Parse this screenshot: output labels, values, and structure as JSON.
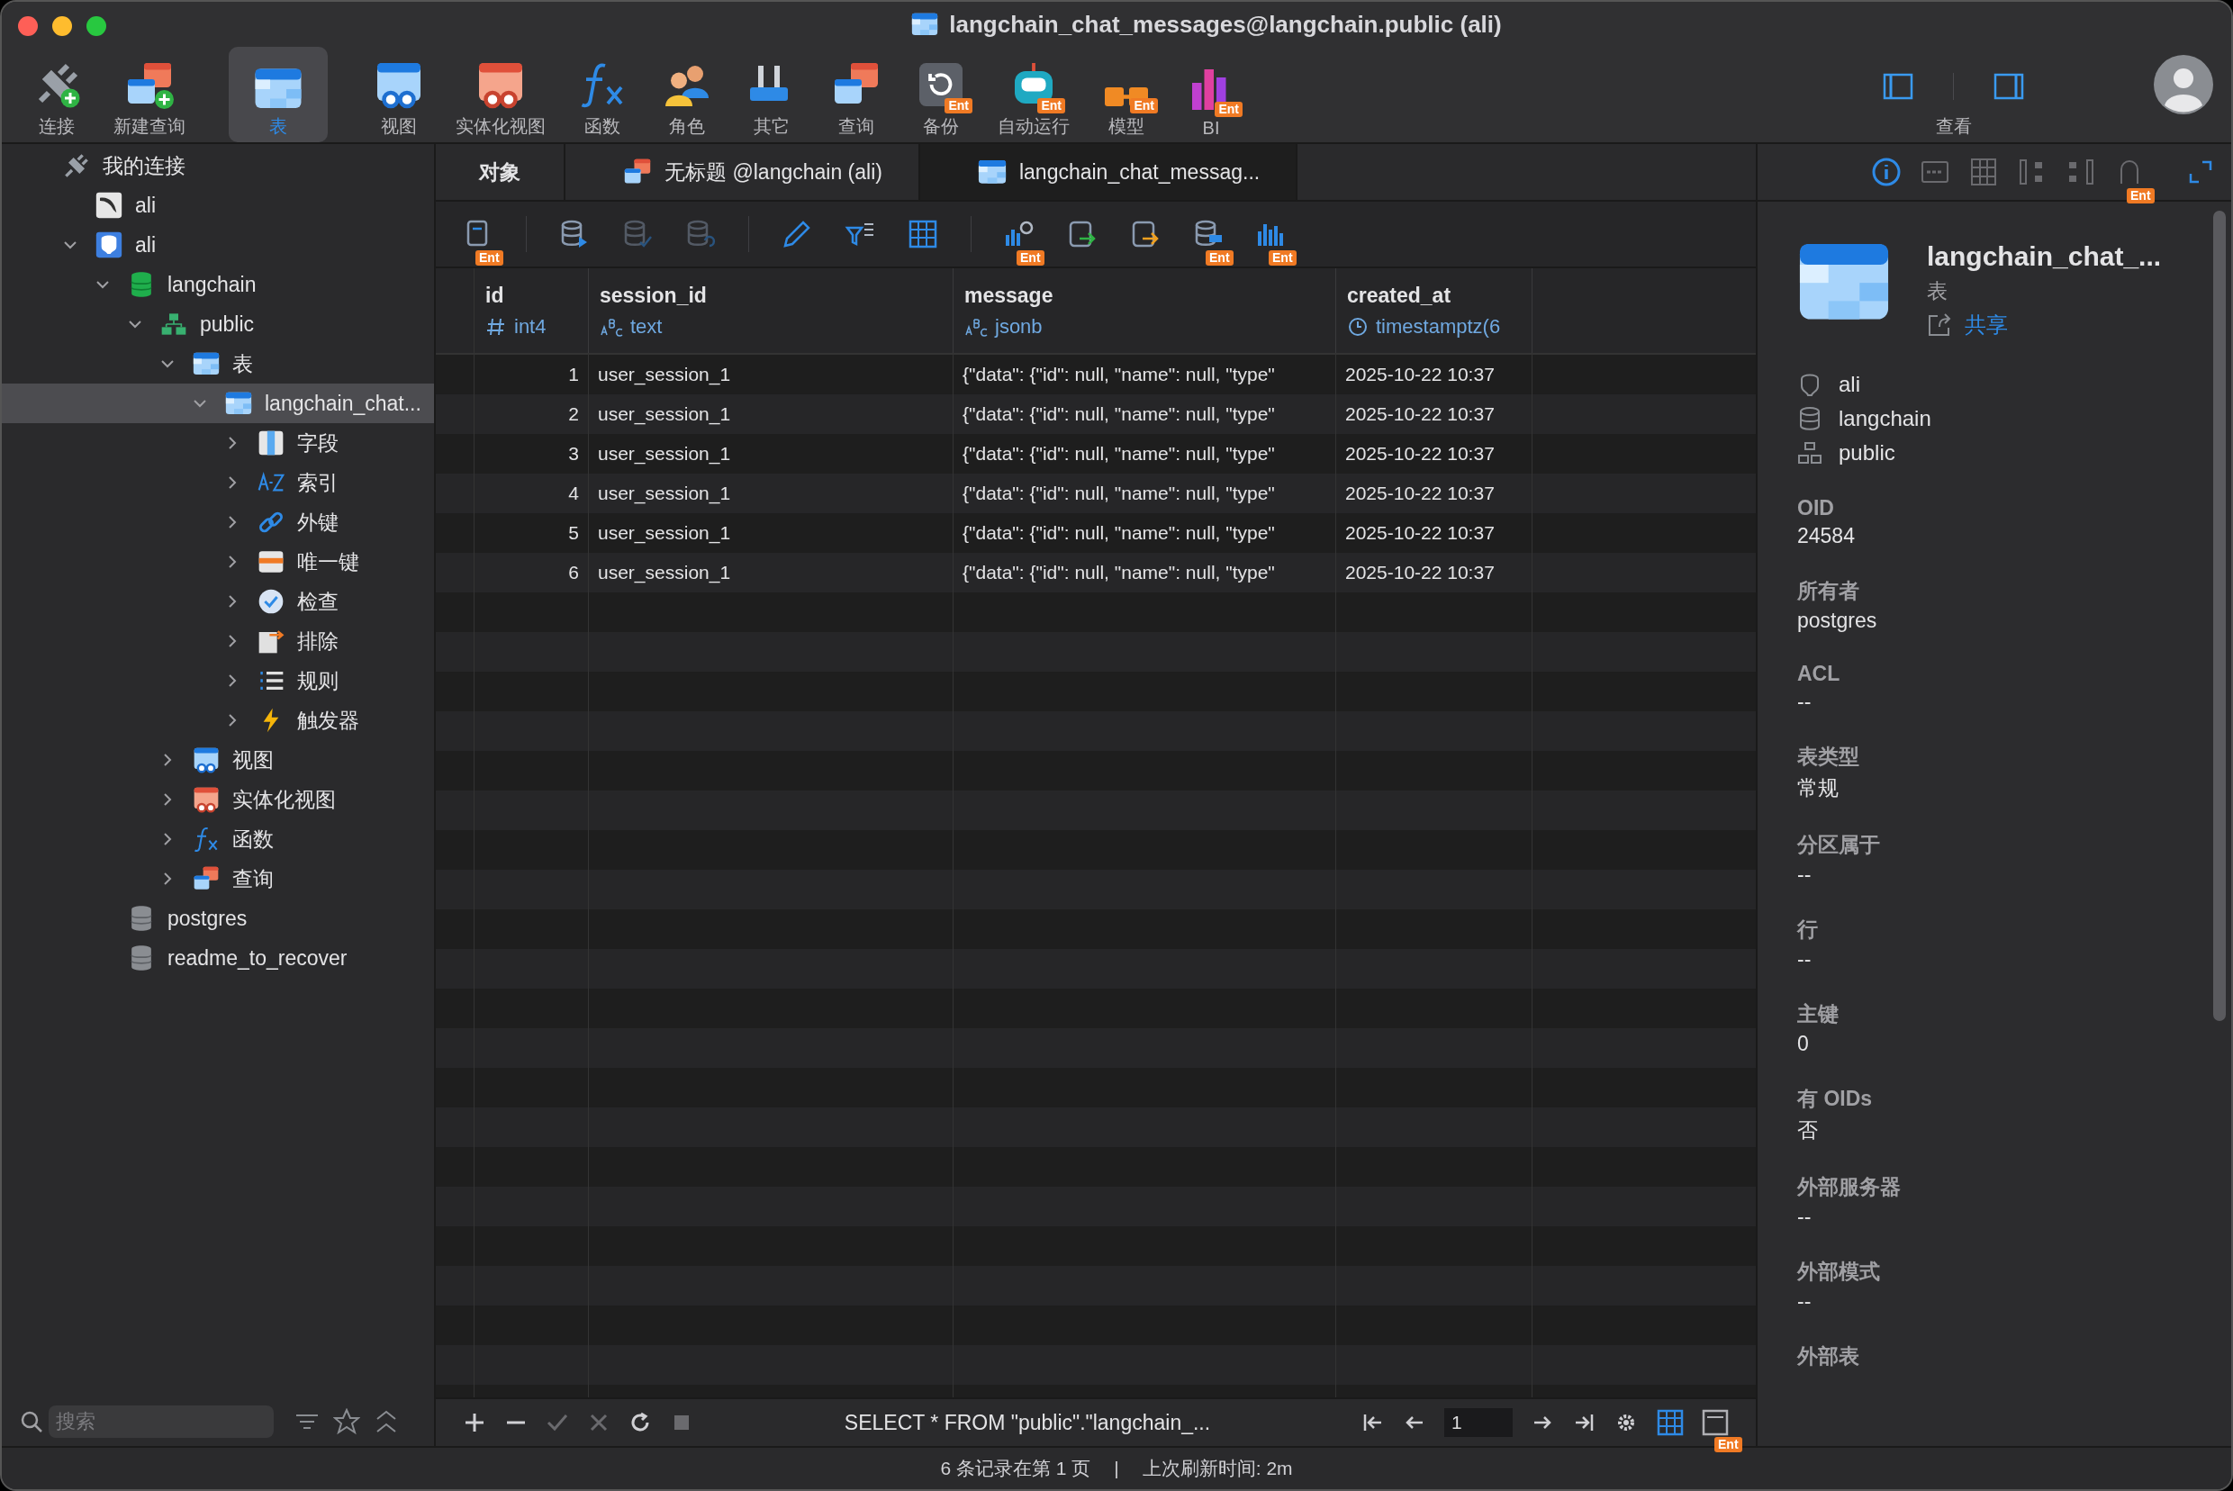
{
  "window": {
    "title": "langchain_chat_messages@langchain.public (ali)"
  },
  "toolbar": [
    {
      "label": "连接",
      "kind": "connect",
      "selected": false
    },
    {
      "label": "新建查询",
      "kind": "newquery",
      "selected": false
    },
    {
      "label": "表",
      "kind": "table",
      "selected": true
    },
    {
      "label": "视图",
      "kind": "view",
      "selected": false
    },
    {
      "label": "实体化视图",
      "kind": "matview",
      "selected": false
    },
    {
      "label": "函数",
      "kind": "function",
      "selected": false
    },
    {
      "label": "角色",
      "kind": "role",
      "selected": false
    },
    {
      "label": "其它",
      "kind": "other",
      "selected": false
    },
    {
      "label": "查询",
      "kind": "query",
      "selected": false
    },
    {
      "label": "备份",
      "kind": "backup",
      "badge": "Ent",
      "selected": false
    },
    {
      "label": "自动运行",
      "kind": "robot",
      "badge": "Ent",
      "selected": false
    },
    {
      "label": "模型",
      "kind": "model",
      "badge": "Ent",
      "selected": false
    },
    {
      "label": "BI",
      "kind": "bi",
      "badge": "Ent",
      "selected": false
    }
  ],
  "view_group": {
    "label": "查看"
  },
  "sidebar": {
    "tree": [
      {
        "label": "我的连接",
        "kind": "connections",
        "selected": false,
        "children": [
          {
            "label": "ali",
            "kind": "mysql",
            "selected": false
          },
          {
            "label": "ali",
            "kind": "postgres",
            "selected": false,
            "expanded": true,
            "children": [
              {
                "label": "langchain",
                "kind": "db-open",
                "selected": false,
                "expanded": true,
                "children": [
                  {
                    "label": "public",
                    "kind": "schema",
                    "selected": false,
                    "expanded": true,
                    "children": [
                      {
                        "label": "表",
                        "kind": "table",
                        "selected": false,
                        "expanded": true,
                        "children": [
                          {
                            "label": "langchain_chat...",
                            "kind": "table",
                            "selected": true,
                            "expanded": true,
                            "children": [
                              {
                                "label": "字段",
                                "kind": "fields",
                                "selected": false,
                                "expanded": false
                              },
                              {
                                "label": "索引",
                                "kind": "index",
                                "selected": false,
                                "expanded": false
                              },
                              {
                                "label": "外键",
                                "kind": "link",
                                "selected": false,
                                "expanded": false
                              },
                              {
                                "label": "唯一键",
                                "kind": "unique",
                                "selected": false,
                                "expanded": false
                              },
                              {
                                "label": "检查",
                                "kind": "check",
                                "selected": false,
                                "expanded": false
                              },
                              {
                                "label": "排除",
                                "kind": "exclude",
                                "selected": false,
                                "expanded": false
                              },
                              {
                                "label": "规则",
                                "kind": "rules",
                                "selected": false,
                                "expanded": false
                              },
                              {
                                "label": "触发器",
                                "kind": "trigger",
                                "selected": false,
                                "expanded": false
                              }
                            ]
                          }
                        ]
                      },
                      {
                        "label": "视图",
                        "kind": "view",
                        "selected": false,
                        "expanded": false
                      },
                      {
                        "label": "实体化视图",
                        "kind": "matview",
                        "selected": false,
                        "expanded": false
                      },
                      {
                        "label": "函数",
                        "kind": "function",
                        "selected": false,
                        "expanded": false
                      },
                      {
                        "label": "查询",
                        "kind": "query",
                        "selected": false,
                        "expanded": false
                      }
                    ]
                  }
                ]
              },
              {
                "label": "postgres",
                "kind": "db",
                "selected": false
              },
              {
                "label": "readme_to_recover",
                "kind": "db",
                "selected": false
              }
            ]
          }
        ]
      }
    ],
    "search": {
      "placeholder": "搜索"
    }
  },
  "tabs": [
    {
      "label": "对象",
      "kind": "plain",
      "selected": false
    },
    {
      "label": "无标题 @langchain (ali)",
      "kind": "query",
      "selected": false
    },
    {
      "label": "langchain_chat_messag...",
      "kind": "table",
      "selected": true
    }
  ],
  "table_toolbar": [
    {
      "kind": "form",
      "badge": "Ent",
      "disabled": false
    },
    {
      "kind": "db-run",
      "disabled": false
    },
    {
      "kind": "db-check",
      "disabled": true
    },
    {
      "kind": "db-undo",
      "disabled": true
    },
    {
      "kind": "edit",
      "disabled": false
    },
    {
      "kind": "filter",
      "disabled": false
    },
    {
      "kind": "grid",
      "disabled": false
    },
    {
      "kind": "chart-search",
      "badge": "Ent",
      "disabled": false
    },
    {
      "kind": "import",
      "disabled": false
    },
    {
      "kind": "export",
      "disabled": false
    },
    {
      "kind": "db-bin",
      "badge": "Ent",
      "disabled": false
    },
    {
      "kind": "bars",
      "badge": "Ent",
      "disabled": false
    }
  ],
  "table": {
    "columns": [
      {
        "name": "id",
        "type": "int4",
        "kind": "number"
      },
      {
        "name": "session_id",
        "type": "text",
        "kind": "text"
      },
      {
        "name": "message",
        "type": "jsonb",
        "kind": "text"
      },
      {
        "name": "created_at",
        "type": "timestamptz(6",
        "kind": "time"
      }
    ],
    "rows": [
      [
        "1",
        "user_session_1",
        "{\"data\": {\"id\": null, \"name\": null, \"type\"",
        "2025-10-22 10:37"
      ],
      [
        "2",
        "user_session_1",
        "{\"data\": {\"id\": null, \"name\": null, \"type\"",
        "2025-10-22 10:37"
      ],
      [
        "3",
        "user_session_1",
        "{\"data\": {\"id\": null, \"name\": null, \"type\"",
        "2025-10-22 10:37"
      ],
      [
        "4",
        "user_session_1",
        "{\"data\": {\"id\": null, \"name\": null, \"type\"",
        "2025-10-22 10:37"
      ],
      [
        "5",
        "user_session_1",
        "{\"data\": {\"id\": null, \"name\": null, \"type\"",
        "2025-10-22 10:37"
      ],
      [
        "6",
        "user_session_1",
        "{\"data\": {\"id\": null, \"name\": null, \"type\"",
        "2025-10-22 10:37"
      ]
    ]
  },
  "bottom_bar": {
    "sql": "SELECT * FROM \"public\".\"langchain_...",
    "page": "1",
    "form_badge": "Ent"
  },
  "status_bar": {
    "records": "6 条记录在第 1 页",
    "separator": "|",
    "refreshed": "上次刷新时间: 2m"
  },
  "info_panel": {
    "tabs": [
      {
        "kind": "info",
        "selected": true
      },
      {
        "kind": "ddl",
        "selected": false
      },
      {
        "kind": "columns",
        "selected": false
      },
      {
        "kind": "deps-left",
        "selected": false
      },
      {
        "kind": "deps-right",
        "selected": false
      },
      {
        "kind": "lock",
        "badge": "Ent",
        "selected": false
      }
    ],
    "title": "langchain_chat_...",
    "subtitle": "表",
    "share": "共享",
    "path": [
      {
        "label": "ali",
        "kind": "postgres"
      },
      {
        "label": "langchain",
        "kind": "db"
      },
      {
        "label": "public",
        "kind": "schema"
      }
    ],
    "properties": [
      {
        "label": "OID",
        "value": "24584"
      },
      {
        "label": "所有者",
        "value": "postgres"
      },
      {
        "label": "ACL",
        "value": "--"
      },
      {
        "label": "表类型",
        "value": "常规"
      },
      {
        "label": "分区属于",
        "value": "--"
      },
      {
        "label": "行",
        "value": "--"
      },
      {
        "label": "主键",
        "value": "0"
      },
      {
        "label": "有 OIDs",
        "value": "否"
      },
      {
        "label": "外部服务器",
        "value": "--"
      },
      {
        "label": "外部模式",
        "value": "--"
      },
      {
        "label": "外部表"
      }
    ]
  }
}
